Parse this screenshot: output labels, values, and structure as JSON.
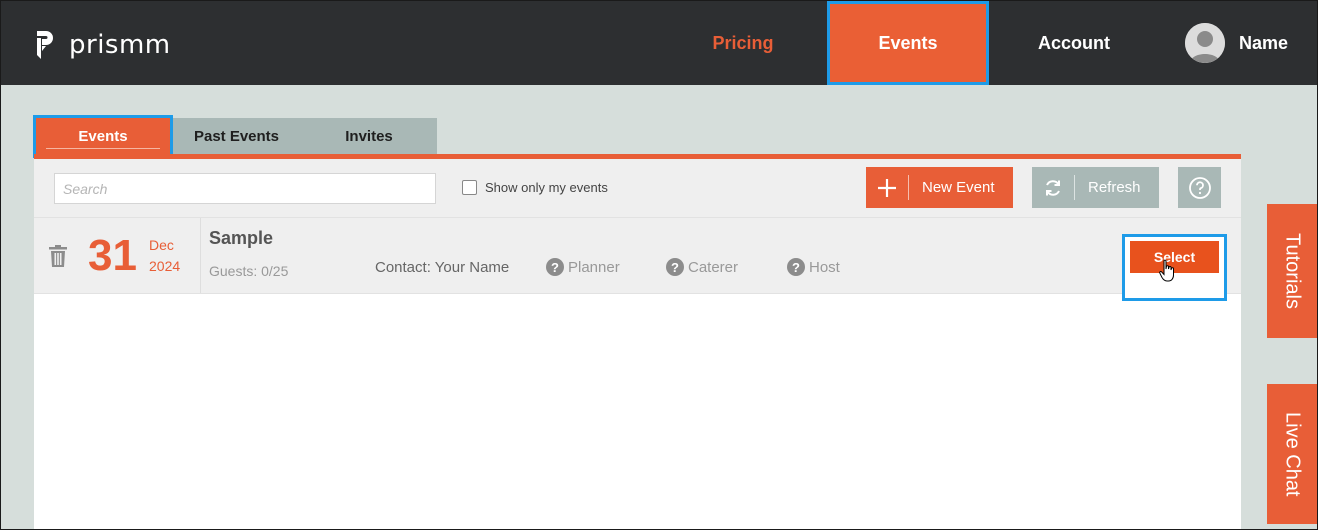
{
  "header": {
    "brand": "prismm",
    "nav": {
      "pricing": "Pricing",
      "events": "Events",
      "account": "Account"
    },
    "user_name": "Name"
  },
  "tabs": {
    "events": "Events",
    "past_events": "Past Events",
    "invites": "Invites"
  },
  "toolbar": {
    "search_placeholder": "Search",
    "show_mine_label": "Show only my events",
    "new_event_label": "New Event",
    "refresh_label": "Refresh"
  },
  "event": {
    "day": "31",
    "month": "Dec",
    "year": "2024",
    "name": "Sample",
    "guests": "Guests: 0/25",
    "contact": "Contact: Your Name",
    "roles": [
      "Planner",
      "Caterer",
      "Host"
    ],
    "select_label": "Select"
  },
  "side": {
    "tutorials": "Tutorials",
    "live_chat": "Live Chat"
  },
  "colors": {
    "accent": "#e85e37",
    "header_bg": "#2d2f31",
    "highlight": "#1e9be8",
    "tab_bg": "#a9b8b6"
  }
}
